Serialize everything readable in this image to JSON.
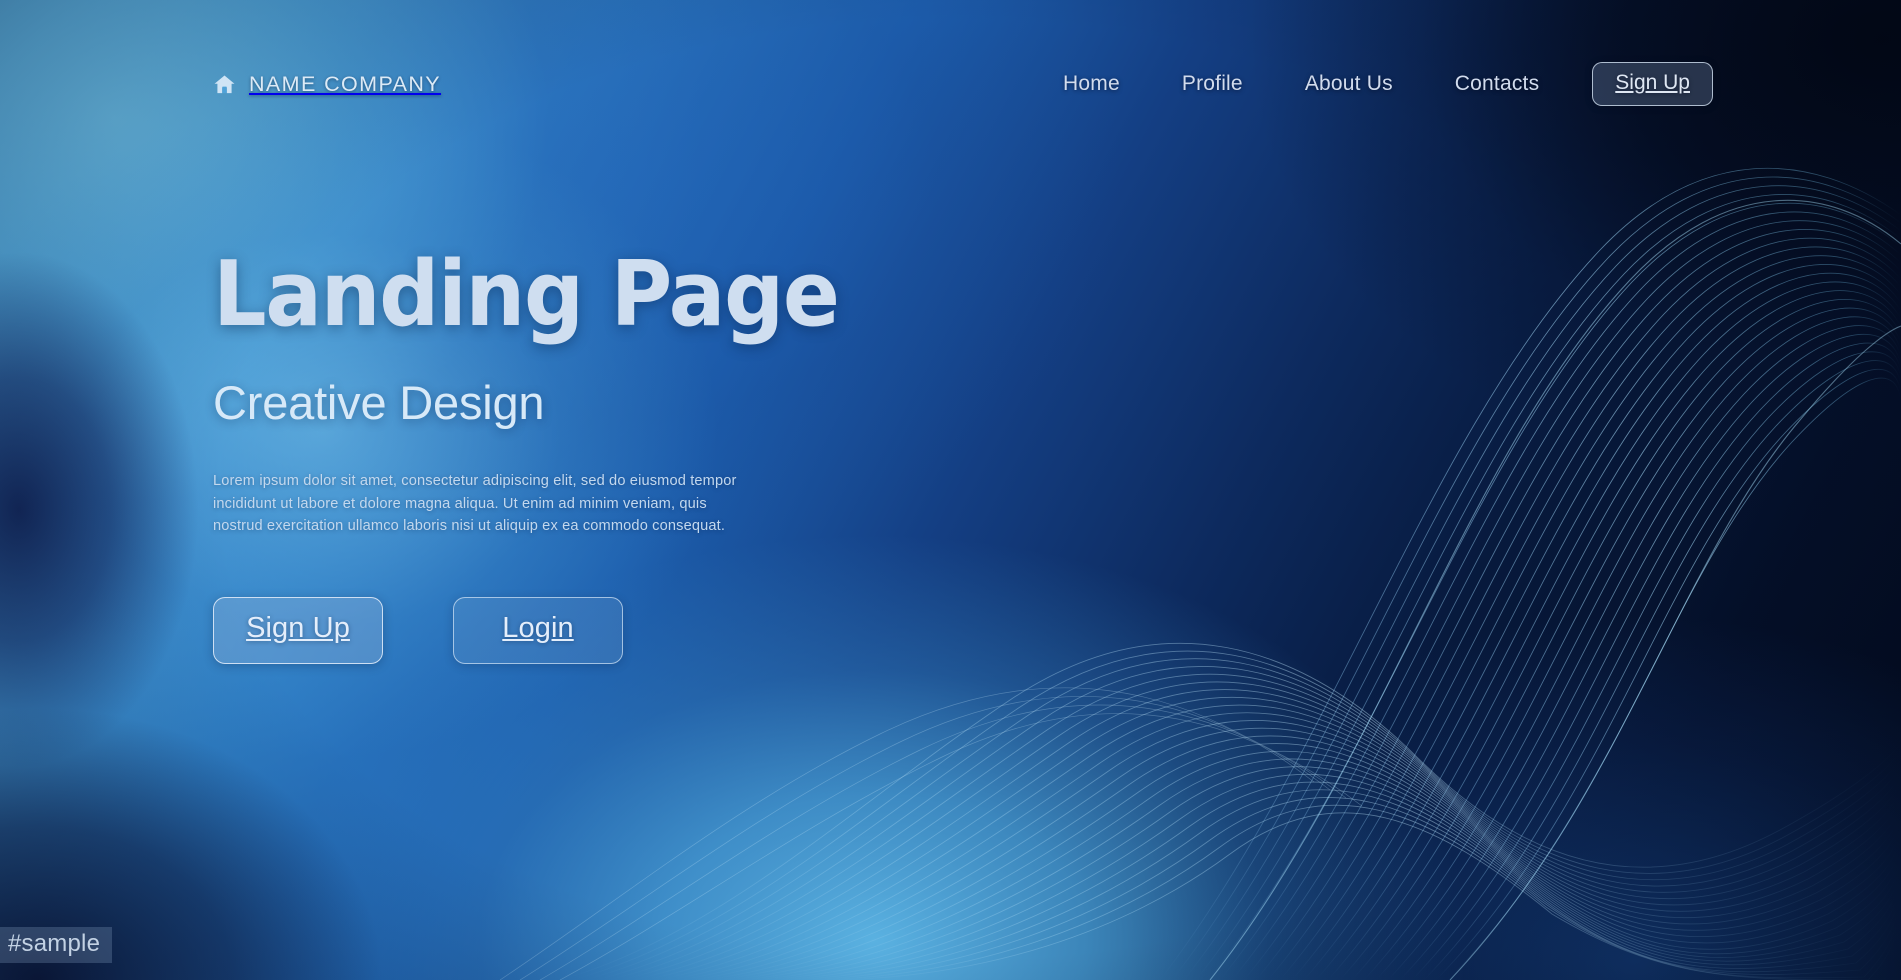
{
  "header": {
    "brand": {
      "icon": "home-icon",
      "name": "NAME COMPANY"
    },
    "nav_links": [
      {
        "label": "Home"
      },
      {
        "label": "Profile"
      },
      {
        "label": "About Us"
      },
      {
        "label": "Contacts"
      }
    ],
    "signup_button": "Sign Up"
  },
  "hero": {
    "title": "Landing Page",
    "subtitle": "Creative Design",
    "body_lines": [
      "Lorem ipsum dolor sit amet, consectetur adipiscing elit, sed do eiusmod tempor",
      "incididunt ut labore et dolore magna aliqua. Ut enim ad minim veniam, quis",
      "nostrud exercitation ullamco laboris nisi ut aliquip ex ea commodo consequat."
    ],
    "primary_button": "Sign Up",
    "secondary_button": "Login"
  },
  "watermark": {
    "label": "#sample"
  },
  "colors": {
    "sky_blue": "#55aade",
    "bright_glow": "#5eb8e7",
    "mid_blue": "#1d5fae",
    "deep_navy": "#07193c",
    "near_black": "#020a1c",
    "title_text": "#cfdef0",
    "subtitle_text": "#d7e9f8",
    "body_text": "#c3d8ee",
    "nav_text": "#d2dced",
    "wave_line": "#7fb4dc"
  }
}
